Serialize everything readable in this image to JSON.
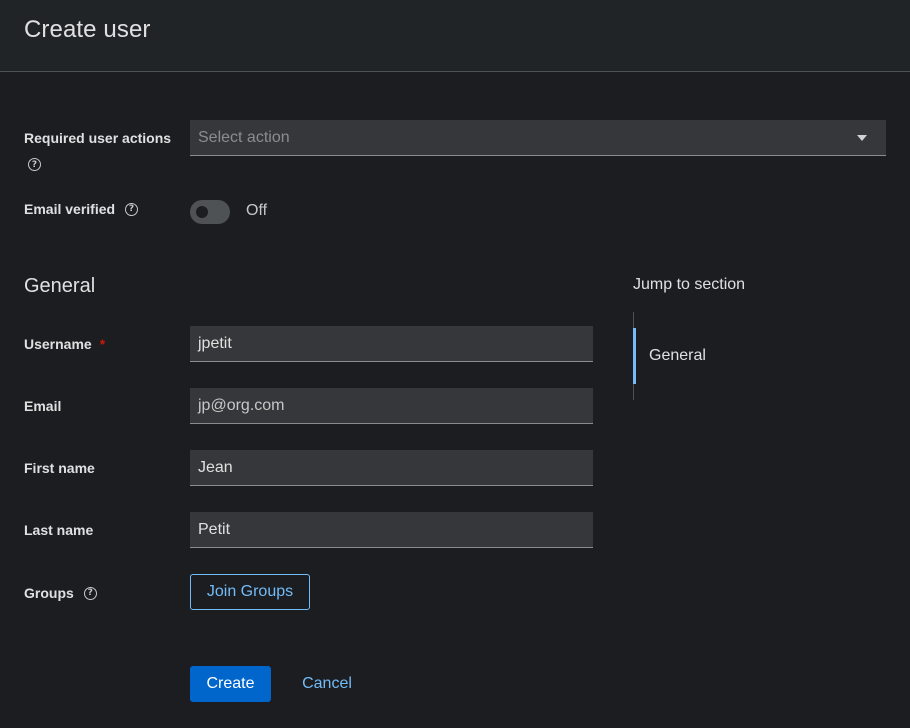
{
  "page": {
    "title": "Create user"
  },
  "required_actions": {
    "label": "Required user actions",
    "placeholder": "Select action"
  },
  "email_verified": {
    "label": "Email verified",
    "state": "Off"
  },
  "general": {
    "title": "General",
    "username": {
      "label": "Username",
      "required_mark": "*",
      "value": "jpetit"
    },
    "email": {
      "label": "Email",
      "value": "jp@org.com"
    },
    "first_name": {
      "label": "First name",
      "value": "Jean"
    },
    "last_name": {
      "label": "Last name",
      "value": "Petit"
    },
    "groups": {
      "label": "Groups",
      "button": "Join Groups"
    }
  },
  "actions": {
    "create": "Create",
    "cancel": "Cancel"
  },
  "jump": {
    "title": "Jump to section",
    "items": [
      {
        "label": "General",
        "active": true
      }
    ]
  },
  "icons": {
    "help": "?"
  },
  "colors": {
    "background": "#1b1d21",
    "header": "#212427",
    "accent": "#73bcf7",
    "primary": "#0066cc",
    "required": "#c9190b"
  }
}
